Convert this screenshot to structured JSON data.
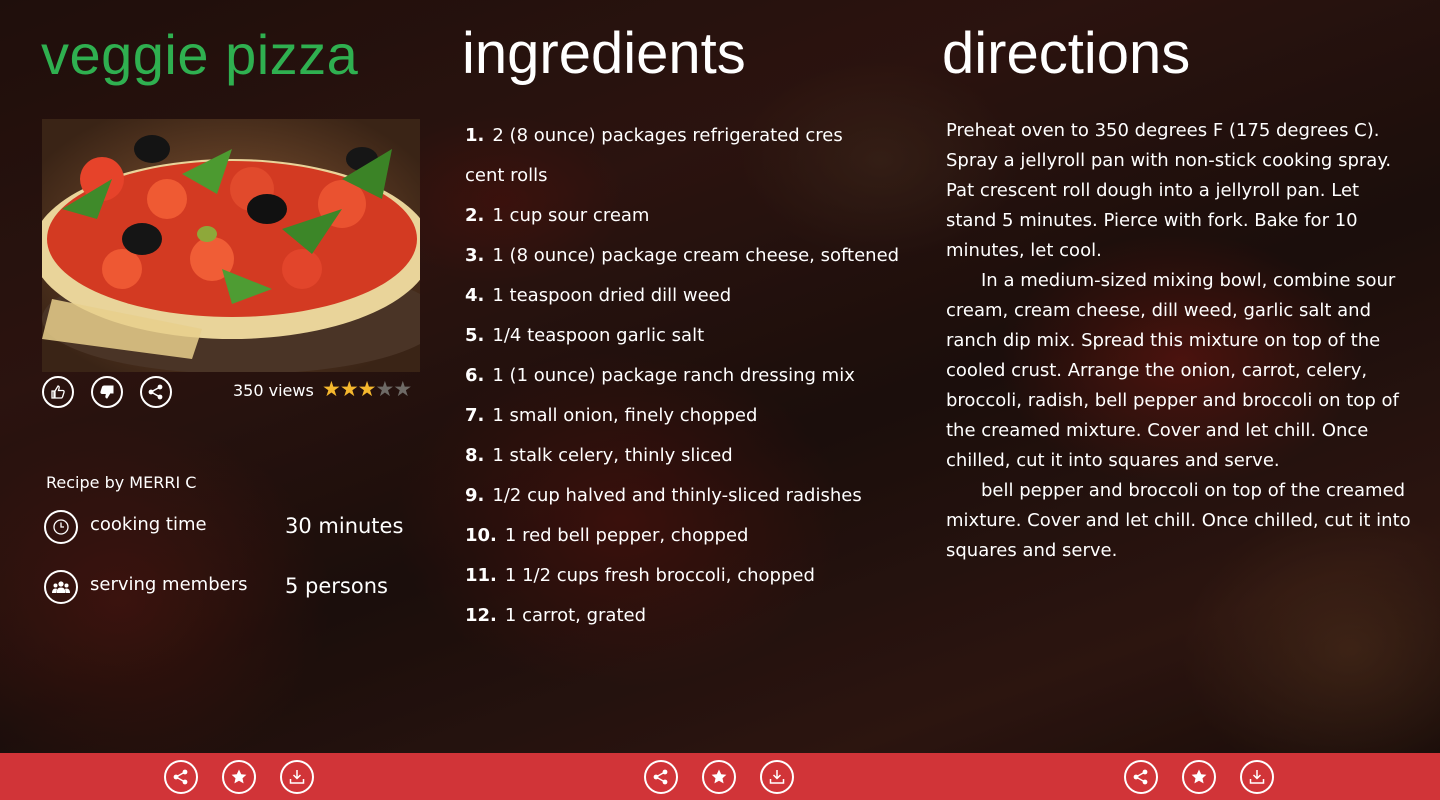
{
  "recipe": {
    "title": "veggie pizza",
    "views": "350 views",
    "rating": 3,
    "rating_max": 5,
    "recipe_by_prefix": "Recipe by",
    "author": "MERRI C",
    "cooking_time_label": "cooking time",
    "cooking_time_value": "30 minutes",
    "serving_label": "serving members",
    "serving_value": "5 persons"
  },
  "ingredients": {
    "heading": "ingredients",
    "items": [
      {
        "num": "1.",
        "text": "2 (8 ounce) packages refrigerated cres"
      },
      {
        "num": "",
        "text": "cent rolls"
      },
      {
        "num": "2.",
        "text": "1 cup sour cream"
      },
      {
        "num": "3.",
        "text": "1 (8 ounce) package cream cheese, softened"
      },
      {
        "num": "4.",
        "text": "1 teaspoon dried dill weed"
      },
      {
        "num": "5.",
        "text": "1/4 teaspoon garlic salt"
      },
      {
        "num": "6.",
        "text": "1 (1 ounce) package ranch dressing mix"
      },
      {
        "num": "7.",
        "text": "1 small onion, finely chopped"
      },
      {
        "num": "8.",
        "text": "1 stalk celery, thinly sliced"
      },
      {
        "num": "9.",
        "text": "1/2 cup halved and thinly-sliced radishes"
      },
      {
        "num": "10.",
        "text": "1 red bell pepper, chopped"
      },
      {
        "num": "11.",
        "text": "1 1/2 cups fresh broccoli, chopped"
      },
      {
        "num": "12.",
        "text": "1 carrot, grated"
      }
    ]
  },
  "directions": {
    "heading": "directions",
    "paragraphs": [
      "Preheat oven to 350 degrees F (175 degrees C). Spray a jellyroll pan with non-stick cooking spray. Pat crescent roll dough into a jellyroll pan. Let stand 5 minutes. Pierce with fork. Bake for 10 minutes, let cool.",
      "In a medium-sized mixing bowl, combine sour cream, cream cheese, dill weed, garlic salt and ranch dip mix. Spread this mixture on top of the cooled crust. Arrange the onion, carrot, celery, broccoli, radish, bell pepper and broccoli on top of the creamed mixture. Cover and let chill. Once chilled, cut it into squares and serve.",
      "bell pepper and broccoli on top of the creamed mixture. Cover and let chill. Once chilled, cut it into squares and serve."
    ]
  },
  "appbar": {
    "groups": [
      {
        "buttons": [
          "share-icon",
          "star-icon",
          "download-icon"
        ]
      },
      {
        "buttons": [
          "share-icon",
          "star-icon",
          "download-icon"
        ]
      },
      {
        "buttons": [
          "share-icon",
          "star-icon",
          "download-icon"
        ]
      }
    ]
  },
  "colors": {
    "title_green": "#2fb050",
    "appbar_red": "#d13438",
    "star_gold": "#f5b82e",
    "star_empty": "#6e6a66"
  }
}
